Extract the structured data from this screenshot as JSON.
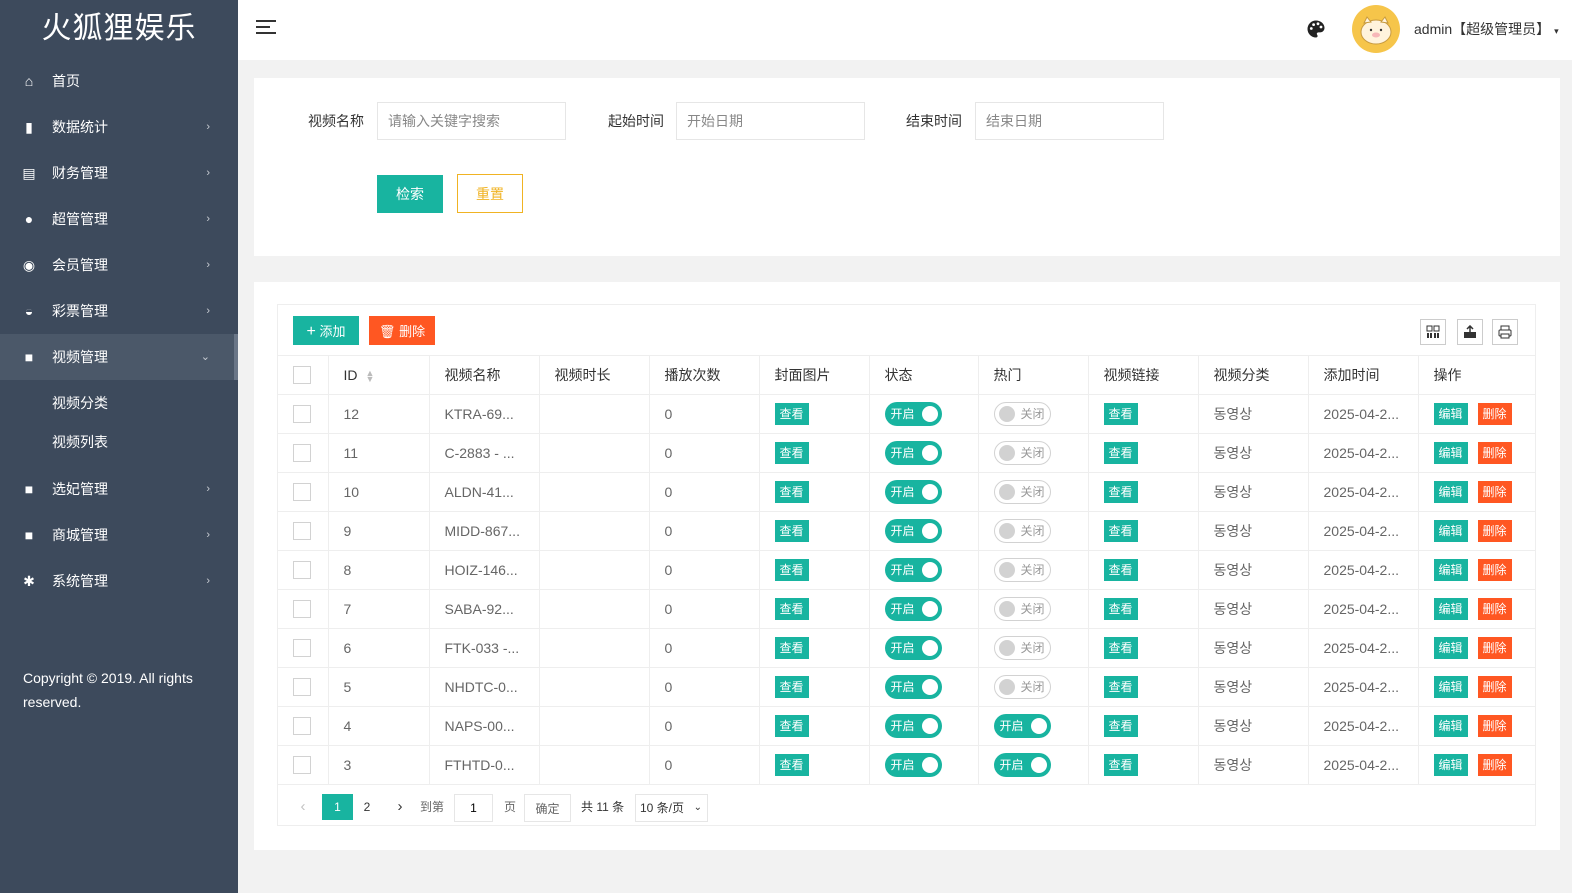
{
  "app": {
    "title": "火狐狸娱乐"
  },
  "sidebar": {
    "items": [
      {
        "label": "首页",
        "icon": "home-icon",
        "has_arrow": false
      },
      {
        "label": "数据统计",
        "icon": "bar-chart-icon",
        "has_arrow": true
      },
      {
        "label": "财务管理",
        "icon": "bank-icon",
        "has_arrow": true
      },
      {
        "label": "超管管理",
        "icon": "user-icon",
        "has_arrow": true
      },
      {
        "label": "会员管理",
        "icon": "users-icon",
        "has_arrow": true
      },
      {
        "label": "彩票管理",
        "icon": "gamepad-icon",
        "has_arrow": true
      },
      {
        "label": "视频管理",
        "icon": "video-icon",
        "has_arrow": true,
        "expanded": true
      },
      {
        "label": "选妃管理",
        "icon": "video-icon",
        "has_arrow": true
      },
      {
        "label": "商城管理",
        "icon": "video-icon",
        "has_arrow": true
      },
      {
        "label": "系统管理",
        "icon": "gear-icon",
        "has_arrow": true
      }
    ],
    "submenu": [
      "视频分类",
      "视频列表"
    ],
    "copyright": "Copyright © 2019. All rights reserved."
  },
  "header": {
    "menu_icon": "hamburger-icon",
    "theme_icon": "palette-icon",
    "user_name": "admin【超级管理员】",
    "caret": "▾"
  },
  "search": {
    "name_label": "视频名称",
    "name_placeholder": "请输入关键字搜索",
    "start_label": "起始时间",
    "start_placeholder": "开始日期",
    "end_label": "结束时间",
    "end_placeholder": "结束日期",
    "search_button": "检索",
    "reset_button": "重置"
  },
  "toolbar": {
    "add_label": "添加",
    "delete_label": "删除",
    "icons": [
      "columns-icon",
      "export-icon",
      "print-icon"
    ]
  },
  "table": {
    "columns": [
      "ID",
      "视频名称",
      "视频时长",
      "播放次数",
      "封面图片",
      "状态",
      "热门",
      "视频链接",
      "视频分类",
      "添加时间",
      "操作"
    ],
    "view_label": "查看",
    "edit_label": "编辑",
    "remove_label": "删除",
    "on_label": "开启",
    "off_label": "关闭",
    "rows": [
      {
        "id": "12",
        "name": "KTRA-69...",
        "duration": "",
        "plays": "0",
        "status_on": true,
        "hot_on": false,
        "category": "동영상",
        "added": "2025-04-2..."
      },
      {
        "id": "11",
        "name": "C-2883 - ...",
        "duration": "",
        "plays": "0",
        "status_on": true,
        "hot_on": false,
        "category": "동영상",
        "added": "2025-04-2..."
      },
      {
        "id": "10",
        "name": "ALDN-41...",
        "duration": "",
        "plays": "0",
        "status_on": true,
        "hot_on": false,
        "category": "동영상",
        "added": "2025-04-2..."
      },
      {
        "id": "9",
        "name": "MIDD-867...",
        "duration": "",
        "plays": "0",
        "status_on": true,
        "hot_on": false,
        "category": "동영상",
        "added": "2025-04-2..."
      },
      {
        "id": "8",
        "name": "HOIZ-146...",
        "duration": "",
        "plays": "0",
        "status_on": true,
        "hot_on": false,
        "category": "동영상",
        "added": "2025-04-2..."
      },
      {
        "id": "7",
        "name": "SABA-92...",
        "duration": "",
        "plays": "0",
        "status_on": true,
        "hot_on": false,
        "category": "동영상",
        "added": "2025-04-2..."
      },
      {
        "id": "6",
        "name": "FTK-033 -...",
        "duration": "",
        "plays": "0",
        "status_on": true,
        "hot_on": false,
        "category": "동영상",
        "added": "2025-04-2..."
      },
      {
        "id": "5",
        "name": "NHDTC-0...",
        "duration": "",
        "plays": "0",
        "status_on": true,
        "hot_on": false,
        "category": "동영상",
        "added": "2025-04-2..."
      },
      {
        "id": "4",
        "name": "NAPS-00...",
        "duration": "",
        "plays": "0",
        "status_on": true,
        "hot_on": true,
        "category": "동영상",
        "added": "2025-04-2..."
      },
      {
        "id": "3",
        "name": "FTHTD-0...",
        "duration": "",
        "plays": "0",
        "status_on": true,
        "hot_on": true,
        "category": "동영상",
        "added": "2025-04-2..."
      }
    ]
  },
  "pagination": {
    "current": "1",
    "pages": [
      "2"
    ],
    "goto_label": "到第",
    "goto_value": "1",
    "page_unit": "页",
    "confirm_label": "确定",
    "total": "共 11 条",
    "limit": "10 条/页"
  },
  "colors": {
    "sidebar": "#3d4a5c",
    "primary": "#18b4a0",
    "danger": "#ff5722",
    "warn": "#f0b323"
  }
}
